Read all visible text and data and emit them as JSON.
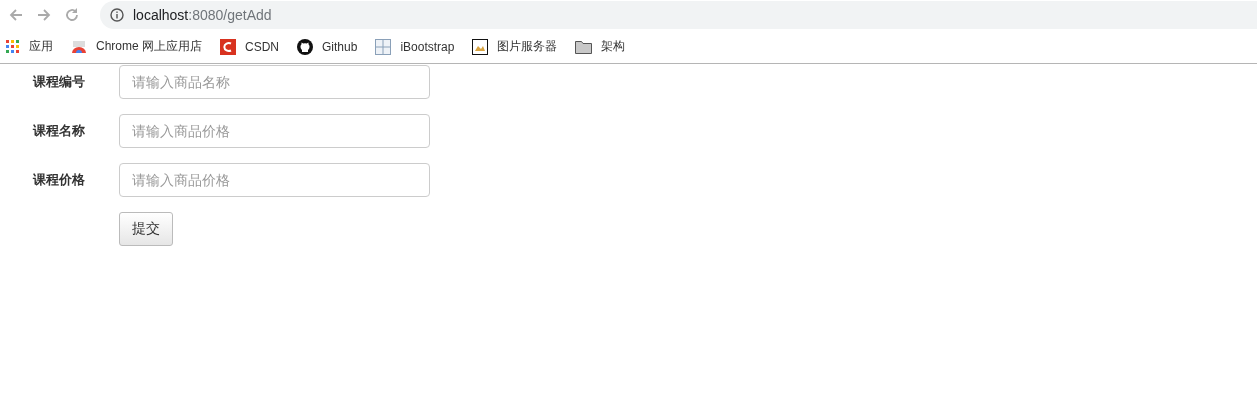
{
  "address_bar": {
    "host": "localhost",
    "path": ":8080/getAdd"
  },
  "bookmarks": [
    {
      "kind": "apps",
      "label": "应用"
    },
    {
      "kind": "store",
      "label": "Chrome 网上应用店"
    },
    {
      "kind": "csdn",
      "label": "CSDN"
    },
    {
      "kind": "github",
      "label": "Github"
    },
    {
      "kind": "grid",
      "label": "iBootstrap"
    },
    {
      "kind": "image",
      "label": "图片服务器"
    },
    {
      "kind": "folder",
      "label": "架构"
    }
  ],
  "form": {
    "fields": [
      {
        "label": "课程编号",
        "placeholder": "请输入商品名称"
      },
      {
        "label": "课程名称",
        "placeholder": "请输入商品价格"
      },
      {
        "label": "课程价格",
        "placeholder": "请输入商品价格"
      }
    ],
    "submit": "提交"
  }
}
